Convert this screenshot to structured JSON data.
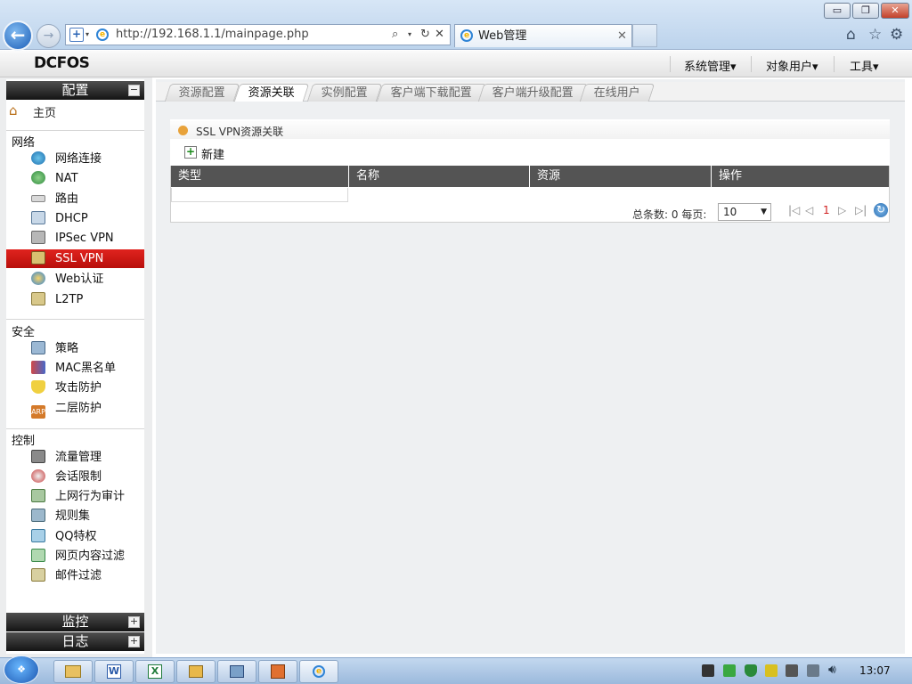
{
  "browser": {
    "url": "http://192.168.1.1/mainpage.php",
    "tab_title": "Web管理",
    "window_buttons": {
      "minimize": "▭",
      "restore": "❐",
      "close": "✕"
    }
  },
  "app": {
    "logo": "DCFOS",
    "top_menu": [
      "系统管理▾",
      "对象用户▾",
      "工具▾"
    ]
  },
  "sidebar": {
    "config_header": "配置",
    "home": "主页",
    "groups": [
      {
        "label": "网络",
        "items": [
          "网络连接",
          "NAT",
          "路由",
          "DHCP",
          "IPSec VPN",
          "SSL VPN",
          "Web认证",
          "L2TP"
        ]
      },
      {
        "label": "安全",
        "items": [
          "策略",
          "MAC黑名单",
          "攻击防护",
          "二层防护"
        ]
      },
      {
        "label": "控制",
        "items": [
          "流量管理",
          "会话限制",
          "上网行为审计",
          "规则集",
          "QQ特权",
          "网页内容过滤",
          "邮件过滤"
        ]
      }
    ],
    "active_item": "SSL VPN",
    "monitor_header": "监控",
    "log_header": "日志",
    "collapse_symbol": "−",
    "expand_symbol": "+"
  },
  "tabs": [
    "资源配置",
    "资源关联",
    "实例配置",
    "客户端下载配置",
    "客户端升级配置",
    "在线用户"
  ],
  "active_tab": "资源关联",
  "panel": {
    "title": "SSL VPN资源关联",
    "new_label": "新建",
    "columns": [
      "类型",
      "名称",
      "资源",
      "操作"
    ],
    "total_label": "总条数: 0",
    "per_page_label": "每页:",
    "page_size": "10",
    "current_page": "1"
  },
  "taskbar": {
    "clock": "13:07"
  }
}
